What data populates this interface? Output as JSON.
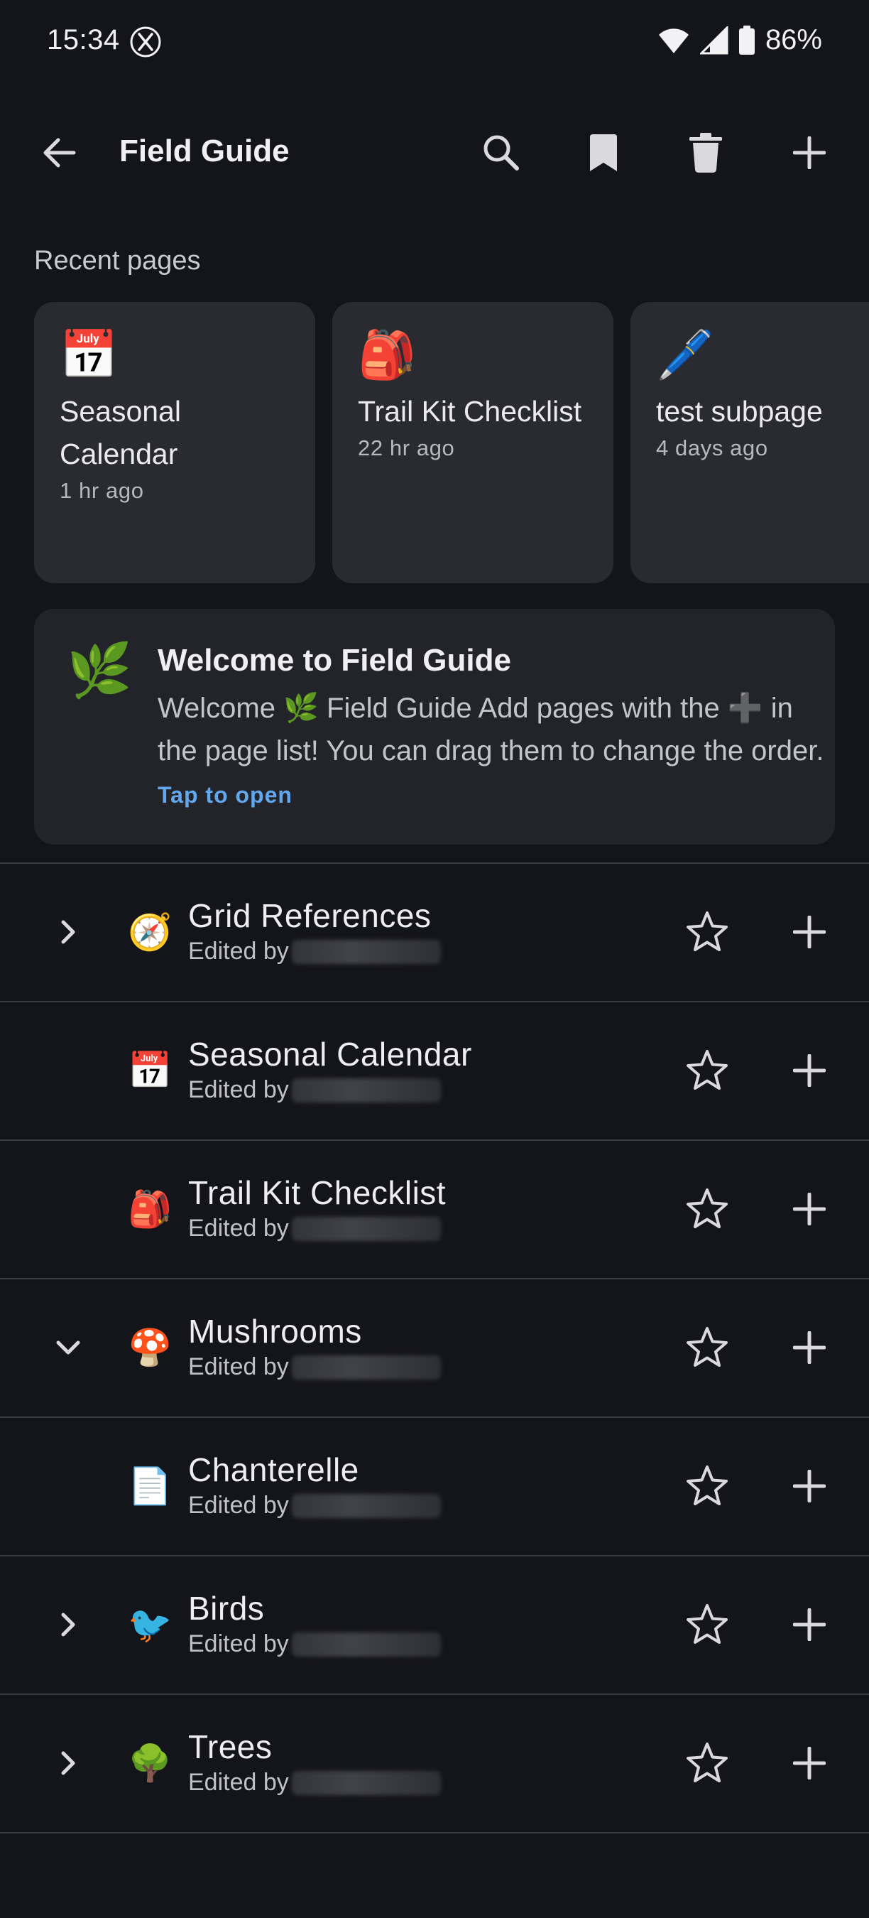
{
  "status_bar": {
    "time": "15:34",
    "battery": "86%"
  },
  "app_bar": {
    "title": "Field Guide"
  },
  "recent": {
    "label": "Recent pages",
    "cards": [
      {
        "emoji": "📅",
        "title": "Seasonal Calendar",
        "time": "1 hr ago"
      },
      {
        "emoji": "🎒",
        "title": "Trail Kit Checklist",
        "time": "22 hr ago"
      },
      {
        "emoji": "🖊️",
        "title": "test subpage",
        "time": "4 days ago"
      }
    ]
  },
  "welcome": {
    "emoji": "🌿",
    "title": "Welcome to Field Guide",
    "body": "Welcome 🌿 Field Guide Add pages with the ➕ in the page list! You can drag them to change the order.",
    "link": "Tap to open"
  },
  "pages": [
    {
      "emoji": "🧭",
      "title": "Grid References",
      "sub": "Edited by",
      "chevron": "right"
    },
    {
      "emoji": "📅",
      "title": "Seasonal Calendar",
      "sub": "Edited by",
      "chevron": "none"
    },
    {
      "emoji": "🎒",
      "title": "Trail Kit Checklist",
      "sub": "Edited by",
      "chevron": "none"
    },
    {
      "emoji": "🍄",
      "title": "Mushrooms",
      "sub": "Edited by",
      "chevron": "down"
    },
    {
      "emoji": "📄",
      "title": "Chanterelle",
      "sub": "Edited by",
      "chevron": "none"
    },
    {
      "emoji": "🐦",
      "title": "Birds",
      "sub": "Edited by",
      "chevron": "right"
    },
    {
      "emoji": "🌳",
      "title": "Trees",
      "sub": "Edited by",
      "chevron": "right"
    }
  ],
  "colors": {
    "background": "#14151a",
    "card": "#2a2b31",
    "welcome_card": "#23242a",
    "link": "#62a8ef",
    "icon": "#d9d9de"
  },
  "icons": {
    "back": "arrow-left-icon",
    "search": "search-icon",
    "bookmark": "bookmark-icon",
    "trash": "trash-icon",
    "add": "plus-icon",
    "star": "star-outline-icon",
    "expand": "chevron-right-icon",
    "collapse": "chevron-down-icon"
  }
}
